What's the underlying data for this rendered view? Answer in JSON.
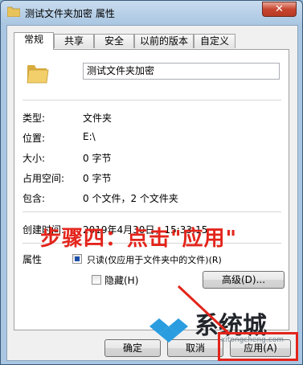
{
  "window": {
    "title": "测试文件夹加密 属性",
    "close_label": "✕"
  },
  "tabs": [
    {
      "label": "常规",
      "active": true
    },
    {
      "label": "共享",
      "active": false
    },
    {
      "label": "安全",
      "active": false
    },
    {
      "label": "以前的版本",
      "active": false
    },
    {
      "label": "自定义",
      "active": false
    }
  ],
  "general": {
    "folder_name": "测试文件夹加密",
    "rows": [
      {
        "label": "类型:",
        "value": "文件夹"
      },
      {
        "label": "位置:",
        "value": "E:\\"
      },
      {
        "label": "大小:",
        "value": "0 字节"
      },
      {
        "label": "占用空间:",
        "value": "0 字节"
      },
      {
        "label": "包含:",
        "value": "0 个文件，2 个文件夹"
      }
    ],
    "created_label": "创建时间:",
    "created_value": "2019年4月30日，15:33:15",
    "attributes_label": "属性",
    "readonly_label": "只读(仅应用于文件夹中的文件)(R)",
    "hidden_label": "隐藏(H)",
    "advanced_label": "高级(D)..."
  },
  "buttons": {
    "ok": "确定",
    "cancel": "取消",
    "apply": "应用(A)",
    "apply_overlay": "应用"
  },
  "annotation": {
    "text": "步骤四：点击\"应用\"",
    "color": "#e3241b"
  },
  "watermark": {
    "text": "系统城",
    "url": "xitongcheng.com"
  }
}
